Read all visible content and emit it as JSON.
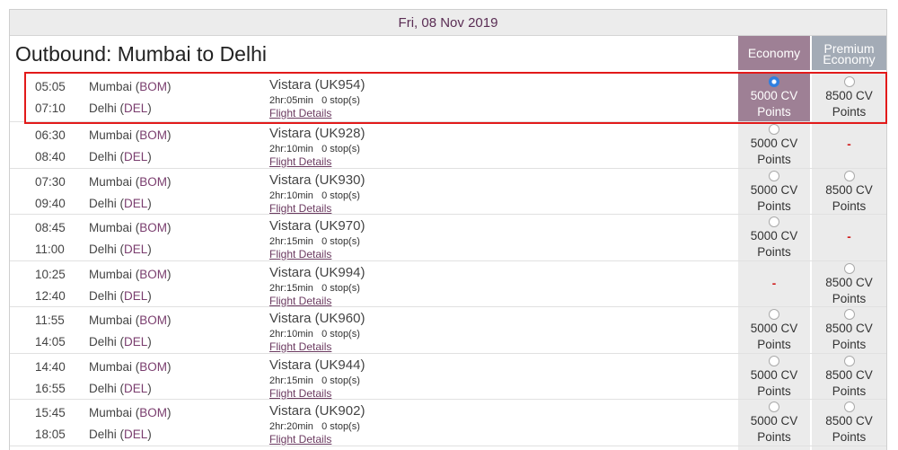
{
  "date": "Fri, 08 Nov 2019",
  "title": "Outbound: Mumbai to Delhi",
  "columns": {
    "economy": "Economy",
    "premium": [
      "Premium",
      "Economy"
    ]
  },
  "details_label": "Flight Details",
  "colors": {
    "economy_header": "#9e8095",
    "premium_header": "#a3abb6",
    "highlight": "#e21a1a",
    "link": "#6b3a60"
  },
  "flights": [
    {
      "dep_time": "05:05",
      "arr_time": "07:10",
      "dep_city": "Mumbai",
      "dep_code": "BOM",
      "arr_city": "Delhi",
      "arr_code": "DEL",
      "airline": "Vistara (UK954)",
      "duration": "2hr:05min",
      "stops": "0 stop(s)",
      "economy": {
        "line1": "5000 CV",
        "line2": "Points",
        "selected": true
      },
      "premium": {
        "line1": "8500 CV",
        "line2": "Points"
      }
    },
    {
      "dep_time": "06:30",
      "arr_time": "08:40",
      "dep_city": "Mumbai",
      "dep_code": "BOM",
      "arr_city": "Delhi",
      "arr_code": "DEL",
      "airline": "Vistara (UK928)",
      "duration": "2hr:10min",
      "stops": "0 stop(s)",
      "economy": {
        "line1": "5000 CV",
        "line2": "Points"
      },
      "premium": null
    },
    {
      "dep_time": "07:30",
      "arr_time": "09:40",
      "dep_city": "Mumbai",
      "dep_code": "BOM",
      "arr_city": "Delhi",
      "arr_code": "DEL",
      "airline": "Vistara (UK930)",
      "duration": "2hr:10min",
      "stops": "0 stop(s)",
      "economy": {
        "line1": "5000 CV",
        "line2": "Points"
      },
      "premium": {
        "line1": "8500 CV",
        "line2": "Points"
      }
    },
    {
      "dep_time": "08:45",
      "arr_time": "11:00",
      "dep_city": "Mumbai",
      "dep_code": "BOM",
      "arr_city": "Delhi",
      "arr_code": "DEL",
      "airline": "Vistara (UK970)",
      "duration": "2hr:15min",
      "stops": "0 stop(s)",
      "economy": {
        "line1": "5000 CV",
        "line2": "Points"
      },
      "premium": null
    },
    {
      "dep_time": "10:25",
      "arr_time": "12:40",
      "dep_city": "Mumbai",
      "dep_code": "BOM",
      "arr_city": "Delhi",
      "arr_code": "DEL",
      "airline": "Vistara (UK994)",
      "duration": "2hr:15min",
      "stops": "0 stop(s)",
      "economy": null,
      "premium": {
        "line1": "8500 CV",
        "line2": "Points"
      }
    },
    {
      "dep_time": "11:55",
      "arr_time": "14:05",
      "dep_city": "Mumbai",
      "dep_code": "BOM",
      "arr_city": "Delhi",
      "arr_code": "DEL",
      "airline": "Vistara (UK960)",
      "duration": "2hr:10min",
      "stops": "0 stop(s)",
      "economy": {
        "line1": "5000 CV",
        "line2": "Points"
      },
      "premium": {
        "line1": "8500 CV",
        "line2": "Points"
      }
    },
    {
      "dep_time": "14:40",
      "arr_time": "16:55",
      "dep_city": "Mumbai",
      "dep_code": "BOM",
      "arr_city": "Delhi",
      "arr_code": "DEL",
      "airline": "Vistara (UK944)",
      "duration": "2hr:15min",
      "stops": "0 stop(s)",
      "economy": {
        "line1": "5000 CV",
        "line2": "Points"
      },
      "premium": {
        "line1": "8500 CV",
        "line2": "Points"
      }
    },
    {
      "dep_time": "15:45",
      "arr_time": "18:05",
      "dep_city": "Mumbai",
      "dep_code": "BOM",
      "arr_city": "Delhi",
      "arr_code": "DEL",
      "airline": "Vistara (UK902)",
      "duration": "2hr:20min",
      "stops": "0 stop(s)",
      "economy": {
        "line1": "5000 CV",
        "line2": "Points"
      },
      "premium": {
        "line1": "8500 CV",
        "line2": "Points"
      }
    }
  ]
}
